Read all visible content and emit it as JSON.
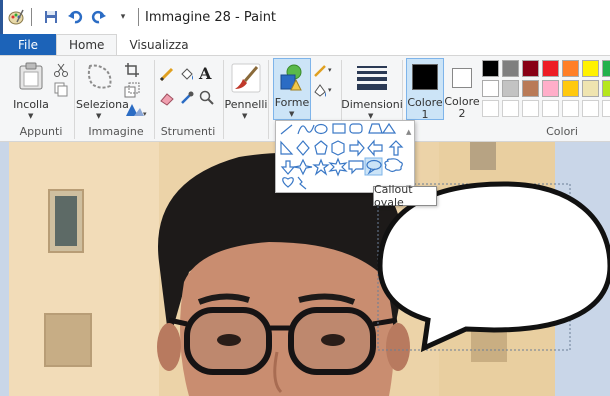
{
  "window": {
    "title": "Immagine 28 - Paint"
  },
  "tabs": {
    "file": "File",
    "home": "Home",
    "view": "Visualizza"
  },
  "ribbon": {
    "paste_label": "Incolla",
    "select_label": "Seleziona",
    "brushes_label": "Pennelli",
    "shapes_label": "Forme",
    "size_label": "Dimensioni",
    "color1_label": "Colore",
    "color1_num": "1",
    "color2_label": "Colore",
    "color2_num": "2",
    "groups": {
      "clipboard": "Appunti",
      "image": "Immagine",
      "tools": "Strumenti",
      "colors": "Colori"
    }
  },
  "colors": {
    "color1": "#000000",
    "color2": "#ffffff",
    "palette_row1": [
      "#000000",
      "#7f7f7f",
      "#880015",
      "#ed1c24",
      "#ff7f27",
      "#fff200",
      "#22b14c"
    ],
    "palette_row2": [
      "#ffffff",
      "#c3c3c3",
      "#b97a57",
      "#ffaec9",
      "#ffc90e",
      "#efe4b0",
      "#b5e61d"
    ]
  },
  "shapes_menu": {
    "tooltip": "Callout ovale"
  }
}
